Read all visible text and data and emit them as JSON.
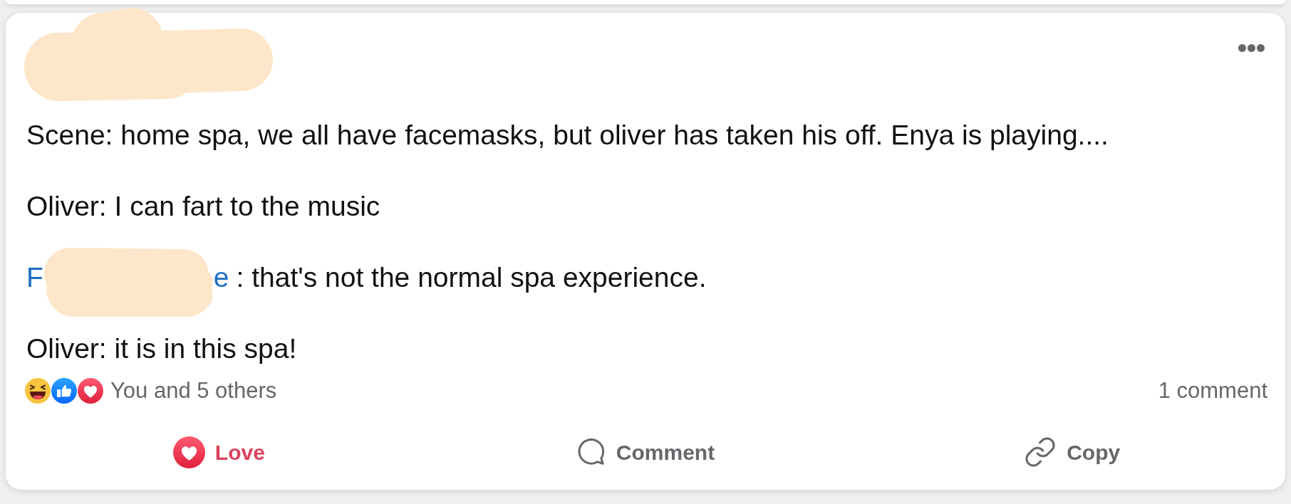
{
  "post": {
    "paragraphs": [
      {
        "kind": "text",
        "text": "Scene: home spa, we all have facemasks, but oliver has taken his off. Enya is playing...."
      },
      {
        "kind": "text",
        "text": "Oliver: I can fart to the music"
      },
      {
        "kind": "mention",
        "mention_start": "F",
        "mention_end": "e",
        "text": ": that's not the normal spa experience."
      },
      {
        "kind": "text",
        "text": "Oliver: it is in this spa!"
      }
    ]
  },
  "reactions_summary": {
    "reactions": [
      {
        "kind": "haha"
      },
      {
        "kind": "like"
      },
      {
        "kind": "love"
      }
    ],
    "text": "You and 5 others",
    "comments": "1 comment"
  },
  "actions": [
    {
      "kind": "react",
      "label": "Love",
      "active": true
    },
    {
      "kind": "comment",
      "label": "Comment",
      "active": false
    },
    {
      "kind": "copy",
      "label": "Copy",
      "active": false
    }
  ]
}
